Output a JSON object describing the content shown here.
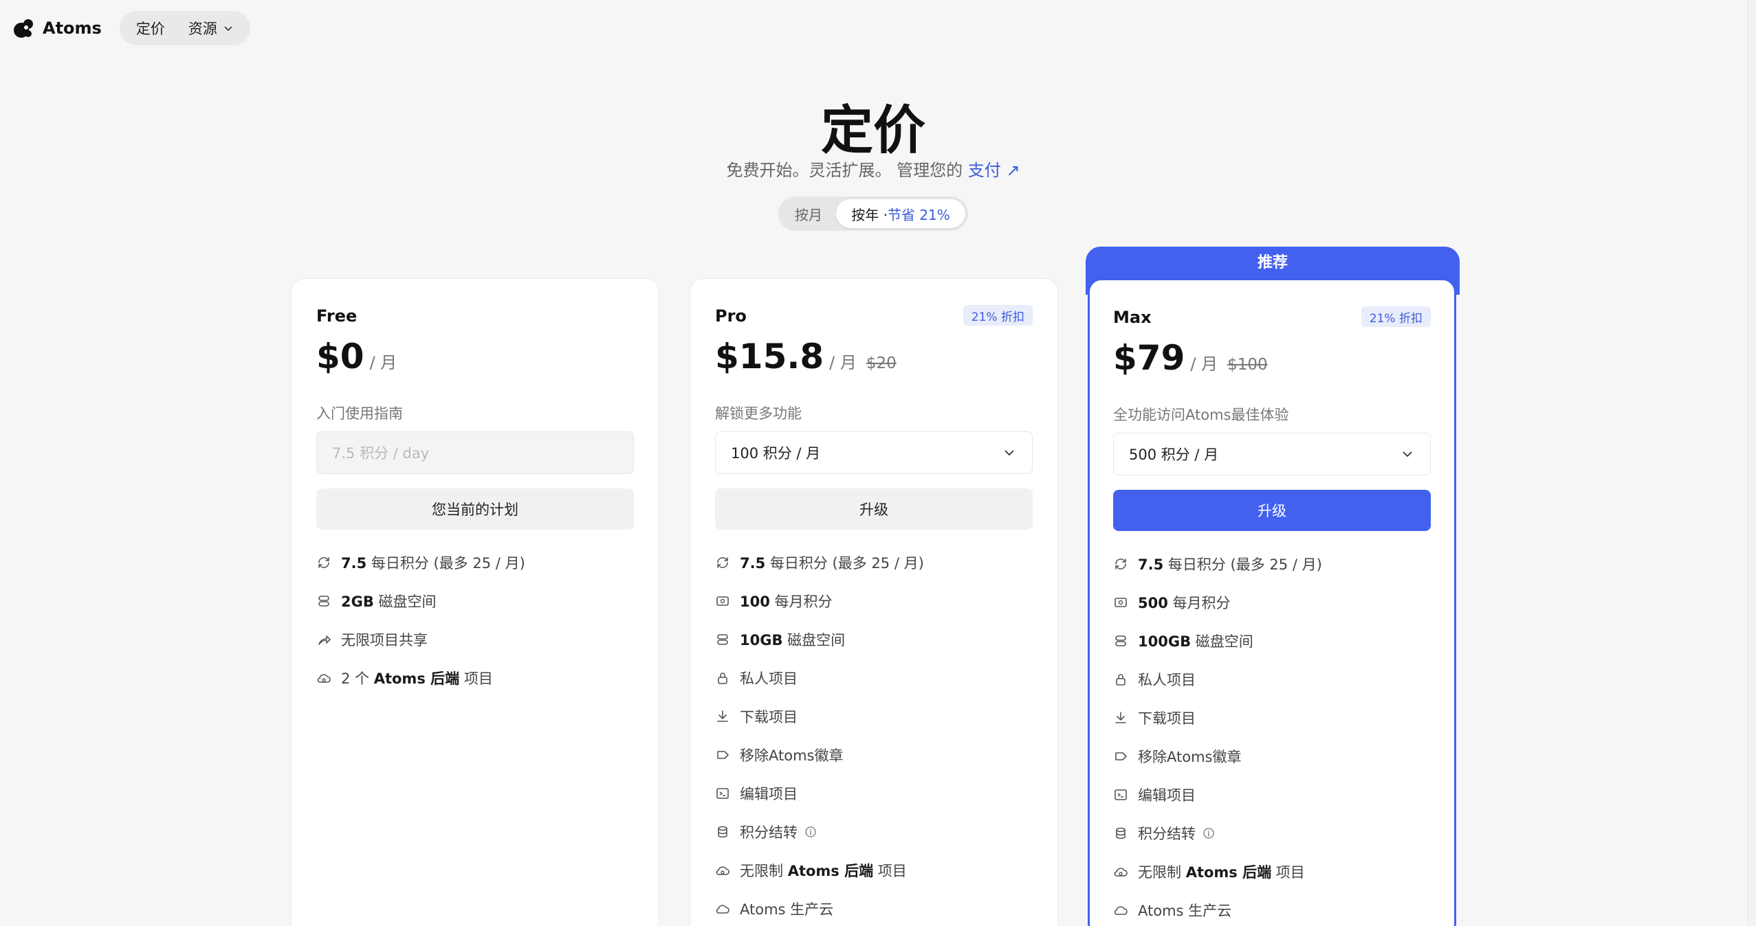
{
  "brand": {
    "name": "Atoms"
  },
  "nav": {
    "pricing": "定价",
    "resources": "资源"
  },
  "hero": {
    "title": "定价",
    "subtitle": "免费开始。灵活扩展。 管理您的",
    "billing_link": "支付 ↗"
  },
  "billing_toggle": {
    "monthly": "按月",
    "yearly": "按年 · ",
    "yearly_save": "节省 21%"
  },
  "colors": {
    "accent": "#4361ee",
    "badge_bg": "#e8ecfb",
    "badge_text": "#3b5bdb"
  },
  "plans": {
    "free": {
      "name": "Free",
      "price": "$0",
      "per": "/ 月",
      "description": "入门使用指南",
      "credits_placeholder": "7.5 积分 / day",
      "cta": "您当前的计划",
      "features": [
        {
          "icon": "refresh-icon",
          "bold": "7.5",
          "text": " 每日积分 (最多 25 / 月)"
        },
        {
          "icon": "database-icon",
          "bold": "2GB",
          "text": " 磁盘空间"
        },
        {
          "icon": "share-icon",
          "bold": "",
          "text": "无限项目共享"
        },
        {
          "icon": "cloud-backend-icon",
          "prefix": "2 个 ",
          "bold": "Atoms 后端",
          "text": " 项目"
        }
      ]
    },
    "pro": {
      "name": "Pro",
      "badge": "21% 折扣",
      "price": "$15.8",
      "per": "/ 月",
      "old_price": "$20",
      "description": "解锁更多功能",
      "credits_selected": "100 积分 / 月",
      "cta": "升级",
      "features": [
        {
          "icon": "refresh-icon",
          "bold": "7.5",
          "text": " 每日积分 (最多 25 / 月)"
        },
        {
          "icon": "credit-card-icon",
          "bold": "100",
          "text": " 每月积分"
        },
        {
          "icon": "database-icon",
          "bold": "10GB",
          "text": " 磁盘空间"
        },
        {
          "icon": "lock-icon",
          "bold": "",
          "text": "私人项目"
        },
        {
          "icon": "download-icon",
          "bold": "",
          "text": "下载项目"
        },
        {
          "icon": "tag-icon",
          "bold": "",
          "text": "移除Atoms徽章"
        },
        {
          "icon": "terminal-icon",
          "bold": "",
          "text": "编辑项目"
        },
        {
          "icon": "coins-icon",
          "bold": "",
          "text": "积分结转"
        },
        {
          "icon": "cloud-backend-icon",
          "prefix": "无限制 ",
          "bold": "Atoms 后端",
          "text": " 项目"
        },
        {
          "icon": "cloud-icon",
          "bold": "",
          "text": "Atoms 生产云"
        }
      ]
    },
    "max": {
      "banner": "推荐",
      "name": "Max",
      "badge": "21% 折扣",
      "price": "$79",
      "per": "/ 月",
      "old_price": "$100",
      "description": "全功能访问Atoms最佳体验",
      "credits_selected": "500 积分 / 月",
      "cta": "升级",
      "features": [
        {
          "icon": "refresh-icon",
          "bold": "7.5",
          "text": " 每日积分 (最多 25 / 月)"
        },
        {
          "icon": "credit-card-icon",
          "bold": "500",
          "text": " 每月积分"
        },
        {
          "icon": "database-icon",
          "bold": "100GB",
          "text": " 磁盘空间"
        },
        {
          "icon": "lock-icon",
          "bold": "",
          "text": "私人项目"
        },
        {
          "icon": "download-icon",
          "bold": "",
          "text": "下载项目"
        },
        {
          "icon": "tag-icon",
          "bold": "",
          "text": "移除Atoms徽章"
        },
        {
          "icon": "terminal-icon",
          "bold": "",
          "text": "编辑项目"
        },
        {
          "icon": "coins-icon",
          "bold": "",
          "text": "积分结转"
        },
        {
          "icon": "cloud-backend-icon",
          "prefix": "无限制 ",
          "bold": "Atoms 后端",
          "text": " 项目"
        },
        {
          "icon": "cloud-icon",
          "bold": "",
          "text": "Atoms 生产云"
        }
      ]
    }
  }
}
